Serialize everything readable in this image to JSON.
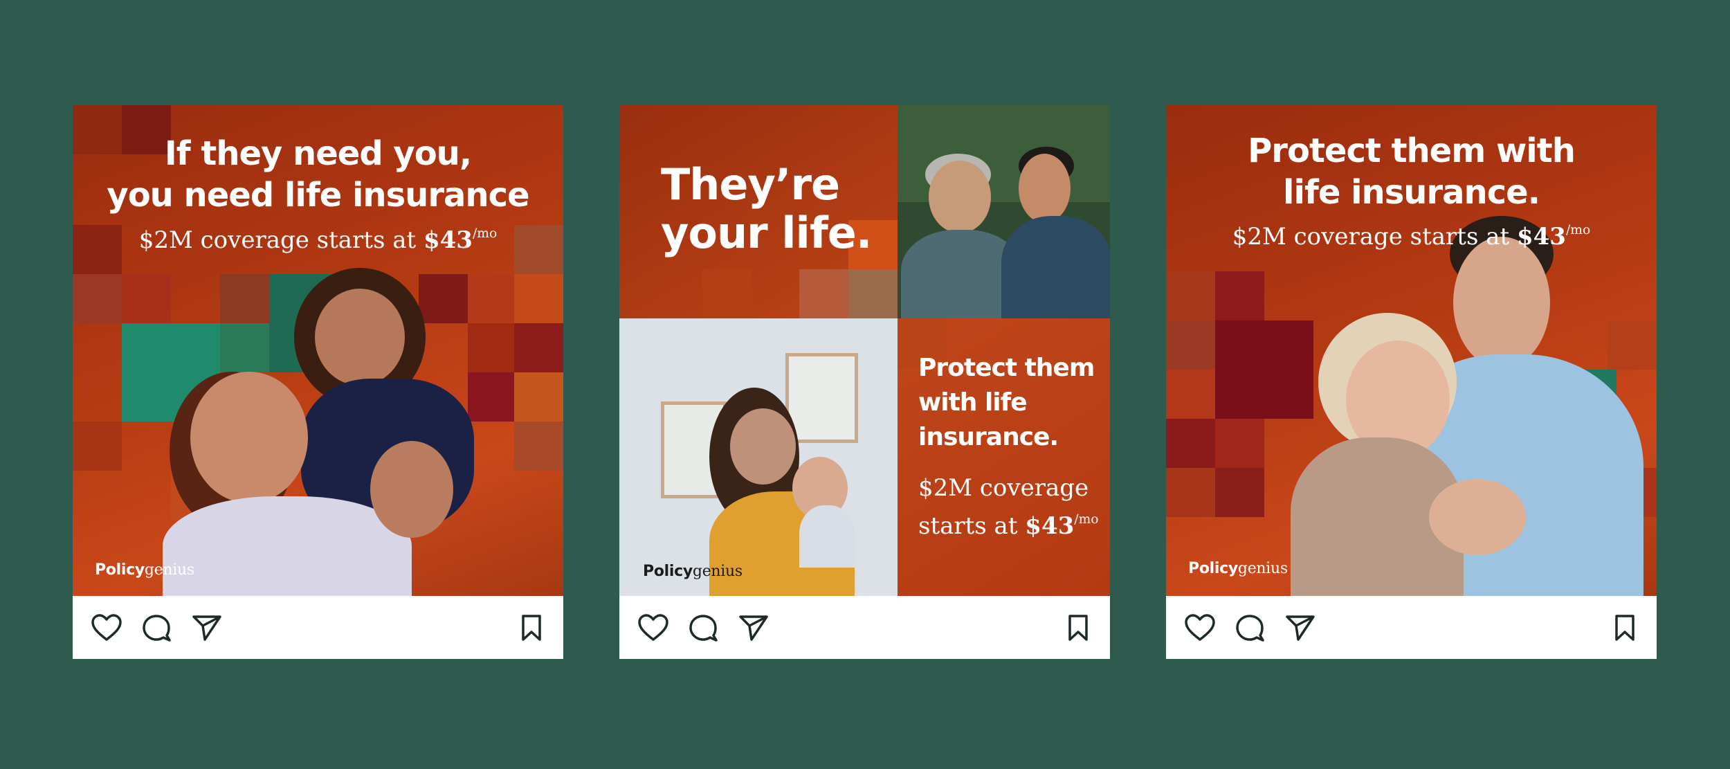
{
  "brand": {
    "logo_bold": "Policy",
    "logo_light": "genius",
    "background": "#2f5a4e",
    "accent_orange": "#c4461a",
    "accent_red": "#8b1a1a",
    "accent_teal": "#1f7a5f"
  },
  "posts": [
    {
      "headline_line1": "If they need you,",
      "headline_line2": "you need life insurance",
      "price_prefix": "$2M coverage starts at ",
      "price_amount": "$43",
      "price_unit": "/mo"
    },
    {
      "headline_line1": "They’re",
      "headline_line2": "your life.",
      "sub_line1": "Protect them",
      "sub_line2": "with life",
      "sub_line3": "insurance.",
      "price_line1": "$2M coverage",
      "price_prefix": "starts at ",
      "price_amount": "$43",
      "price_unit": "/mo"
    },
    {
      "headline_line1": "Protect them with",
      "headline_line2": "life insurance.",
      "price_prefix": "$2M coverage starts at ",
      "price_amount": "$43",
      "price_unit": "/mo"
    }
  ],
  "actions": {
    "icons": [
      "heart-icon",
      "comment-icon",
      "send-icon",
      "bookmark-icon"
    ]
  }
}
